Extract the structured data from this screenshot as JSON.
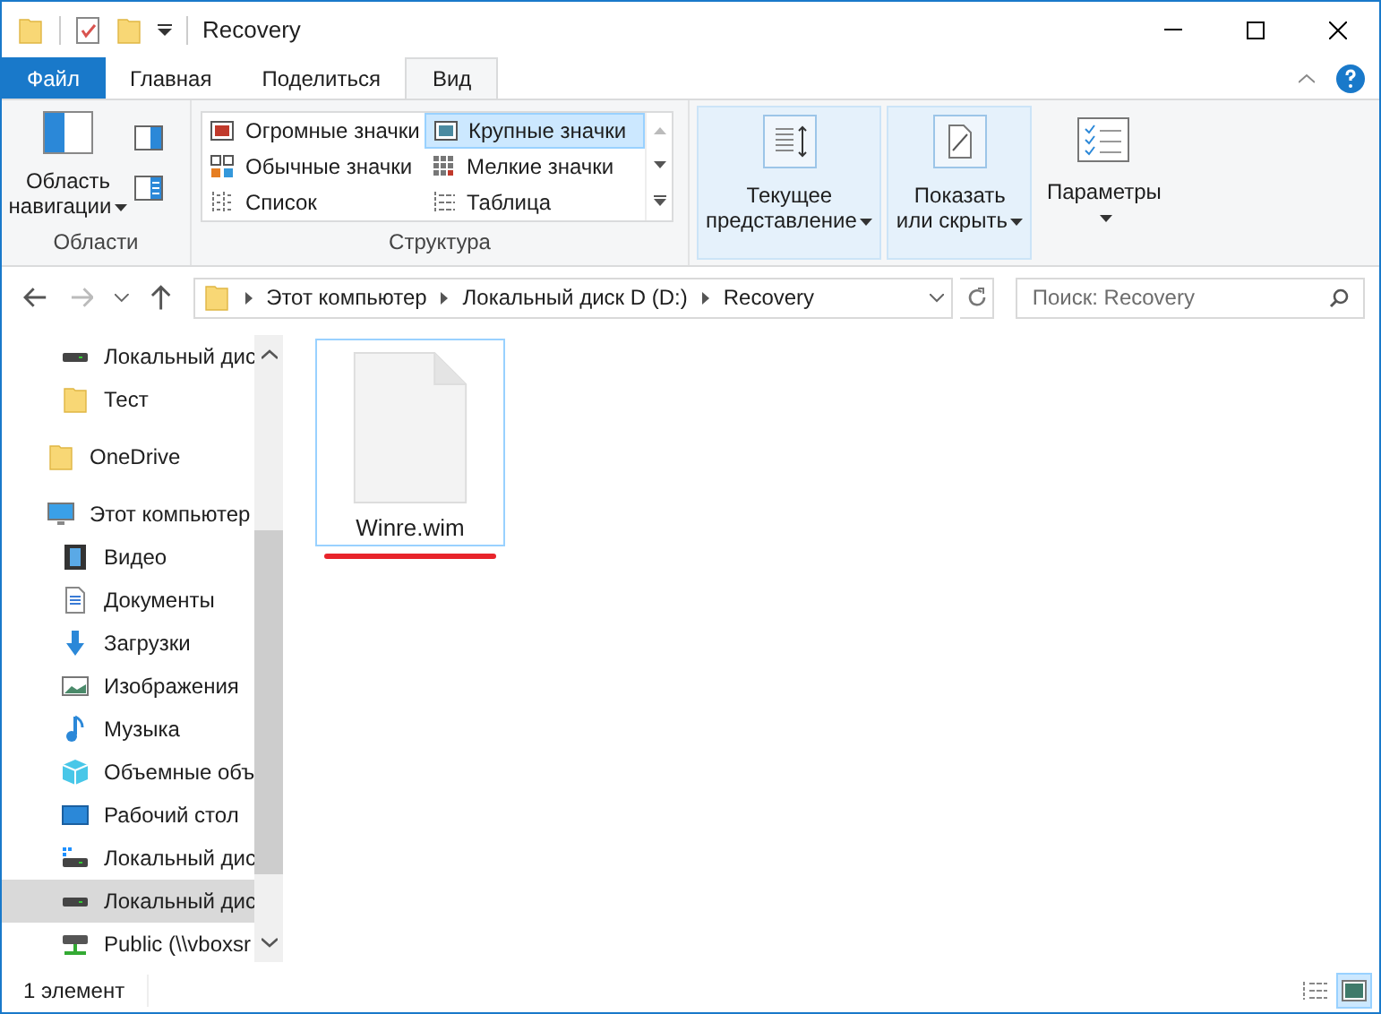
{
  "window": {
    "title": "Recovery"
  },
  "ribbon_tabs": [
    {
      "label": "Файл",
      "kind": "file",
      "selected": false
    },
    {
      "label": "Главная",
      "kind": "tab",
      "selected": false
    },
    {
      "label": "Поделиться",
      "kind": "tab",
      "selected": false
    },
    {
      "label": "Вид",
      "kind": "tab",
      "selected": true
    }
  ],
  "ribbon": {
    "panes_group": {
      "label": "Области",
      "navigation_button": "Область навигации"
    },
    "layout_group": {
      "label": "Структура",
      "options": [
        {
          "label": "Огромные значки",
          "kind": "huge",
          "selected": false
        },
        {
          "label": "Обычные значки",
          "kind": "medium",
          "selected": false
        },
        {
          "label": "Список",
          "kind": "list",
          "selected": false
        },
        {
          "label": "Крупные значки",
          "kind": "large",
          "selected": true
        },
        {
          "label": "Мелкие значки",
          "kind": "small",
          "selected": false
        },
        {
          "label": "Таблица",
          "kind": "details",
          "selected": false
        }
      ]
    },
    "buttons": [
      {
        "label": "Текущее представление",
        "kind": "view",
        "highlighted": true
      },
      {
        "label": "Показать или скрыть",
        "kind": "visibility",
        "highlighted": true
      },
      {
        "label": "Параметры",
        "kind": "options",
        "highlighted": false
      }
    ]
  },
  "navigation": {
    "back_disabled": false,
    "forward_disabled": true,
    "breadcrumbs": [
      "Этот компьютер",
      "Локальный диск D (D:)",
      "Recovery"
    ],
    "search": {
      "placeholder": "Поиск: Recovery"
    }
  },
  "sidebar": {
    "scrolled_items": [
      {
        "label": "Локальный дис",
        "kind": "drive",
        "selected": false
      },
      {
        "label": "Тест",
        "kind": "folder",
        "selected": false
      }
    ],
    "items": [
      {
        "label": "OneDrive",
        "kind": "folder",
        "selected": false
      },
      {
        "label": "Этот компьютер",
        "kind": "computer",
        "selected": false,
        "children": [
          {
            "label": "Видео",
            "kind": "video",
            "selected": false
          },
          {
            "label": "Документы",
            "kind": "documents",
            "selected": false
          },
          {
            "label": "Загрузки",
            "kind": "downloads",
            "selected": false
          },
          {
            "label": "Изображения",
            "kind": "pictures",
            "selected": false
          },
          {
            "label": "Музыка",
            "kind": "music",
            "selected": false
          },
          {
            "label": "Объемные объ",
            "kind": "objects",
            "selected": false
          },
          {
            "label": "Рабочий стол",
            "kind": "desktop",
            "selected": false
          },
          {
            "label": "Локальный дис",
            "kind": "system",
            "selected": false
          },
          {
            "label": "Локальный дис",
            "kind": "drive",
            "selected": true
          },
          {
            "label": "Public (\\\\vboxsr",
            "kind": "network",
            "selected": false
          }
        ]
      }
    ]
  },
  "files": [
    {
      "name": "Winre.wim",
      "hovered": true,
      "underlined": true
    }
  ],
  "status_bar": {
    "count": "1 элемент",
    "views": [
      {
        "kind": "details",
        "selected": false
      },
      {
        "kind": "icons",
        "selected": true
      }
    ]
  }
}
